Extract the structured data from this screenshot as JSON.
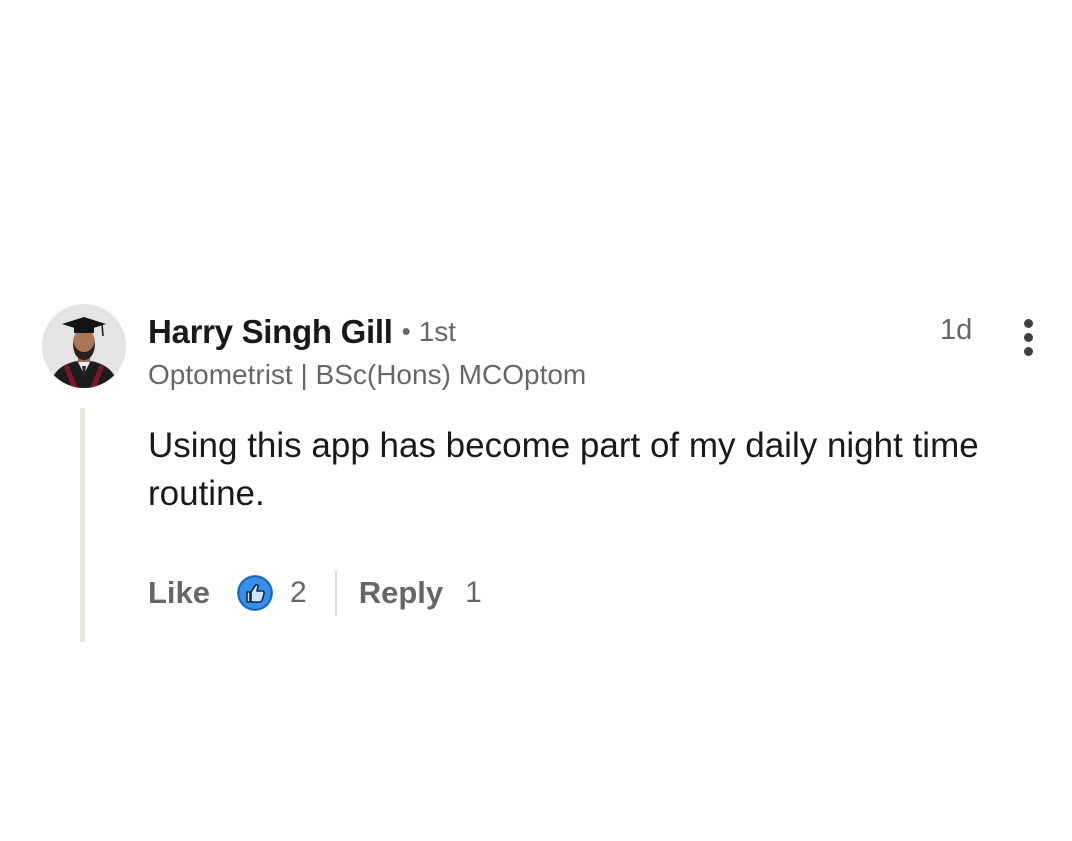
{
  "comment": {
    "author": {
      "name": "Harry Singh Gill",
      "separator": "•",
      "connection_degree": "1st",
      "headline": "Optometrist | BSc(Hons) MCOptom"
    },
    "timestamp": "1d",
    "text": "Using this app has become part of my daily night time routine.",
    "actions": {
      "like_label": "Like",
      "like_count": "2",
      "reply_label": "Reply",
      "reply_count": "1"
    },
    "icons": {
      "avatar": "avatar-photo",
      "reaction": "thumbs-up-icon",
      "more": "more-vertical-icon"
    },
    "colors": {
      "reaction_blue": "#378fe9",
      "thread_line": "#e9e5df"
    }
  }
}
